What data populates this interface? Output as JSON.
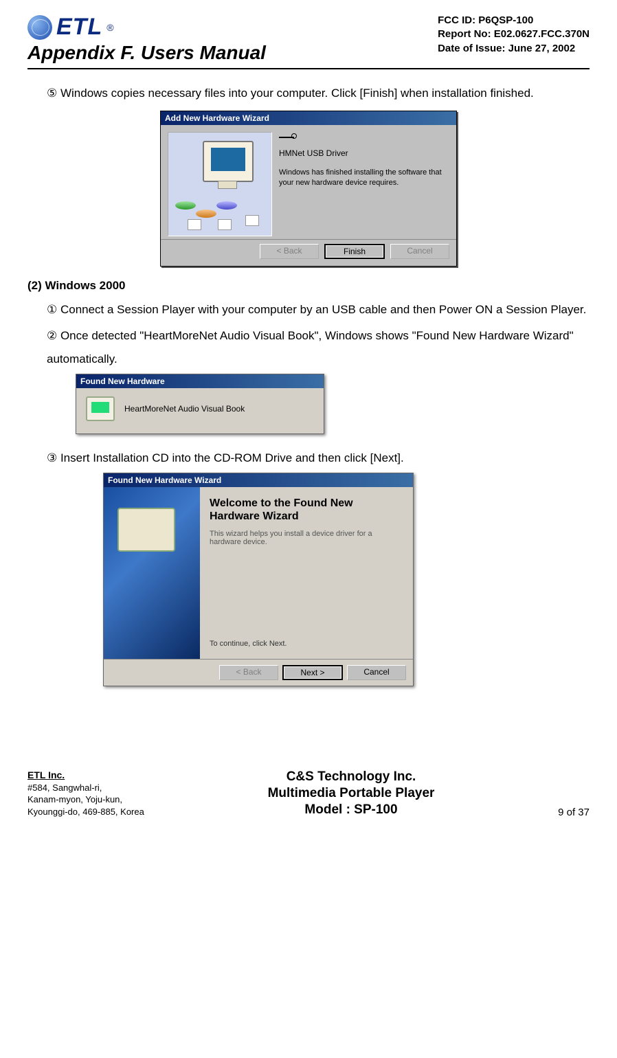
{
  "header": {
    "logo_text": "ETL",
    "logo_reg": "®",
    "fcc_id": "FCC ID: P6QSP-100",
    "report_no": "Report No: E02.0627.FCC.370N",
    "issue_date": "Date of Issue: June 27, 2002",
    "appendix": "Appendix F.  Users Manual"
  },
  "body": {
    "step5": "⑤ Windows copies necessary files into your computer. Click [Finish] when installation finished.",
    "wiz1": {
      "title": "Add New Hardware Wizard",
      "driver": "HMNet USB Driver",
      "msg": "Windows has finished installing the software that your new hardware device requires.",
      "back": "< Back",
      "finish": "Finish",
      "cancel": "Cancel"
    },
    "section2": "(2) Windows 2000",
    "step2_1": "①  Connect a Session Player with your computer by an USB cable and then Power ON a Session Player.",
    "step2_2": "② Once detected \"HeartMoreNet Audio Visual Book\", Windows shows \"Found New Hardware Wizard\" automatically.",
    "fnh": {
      "title": "Found New Hardware",
      "text": "HeartMoreNet Audio Visual Book"
    },
    "step2_3": "③ Insert Installation CD into the CD-ROM Drive and then click [Next].",
    "wiz2": {
      "title": "Found New Hardware Wizard",
      "welcome": "Welcome to the Found New Hardware Wizard",
      "desc": "This wizard helps you install a device driver for a hardware device.",
      "cont": "To continue, click Next.",
      "back": "< Back",
      "next": "Next >",
      "cancel": "Cancel"
    }
  },
  "footer": {
    "company": "ETL Inc.",
    "addr1": "#584, Sangwhal-ri,",
    "addr2": "Kanam-myon, Yoju-kun,",
    "addr3": "Kyounggi-do, 469-885, Korea",
    "center1": "C&S Technology Inc.",
    "center2": "Multimedia Portable Player",
    "center3": "Model : SP-100",
    "page": "9 of 37"
  }
}
